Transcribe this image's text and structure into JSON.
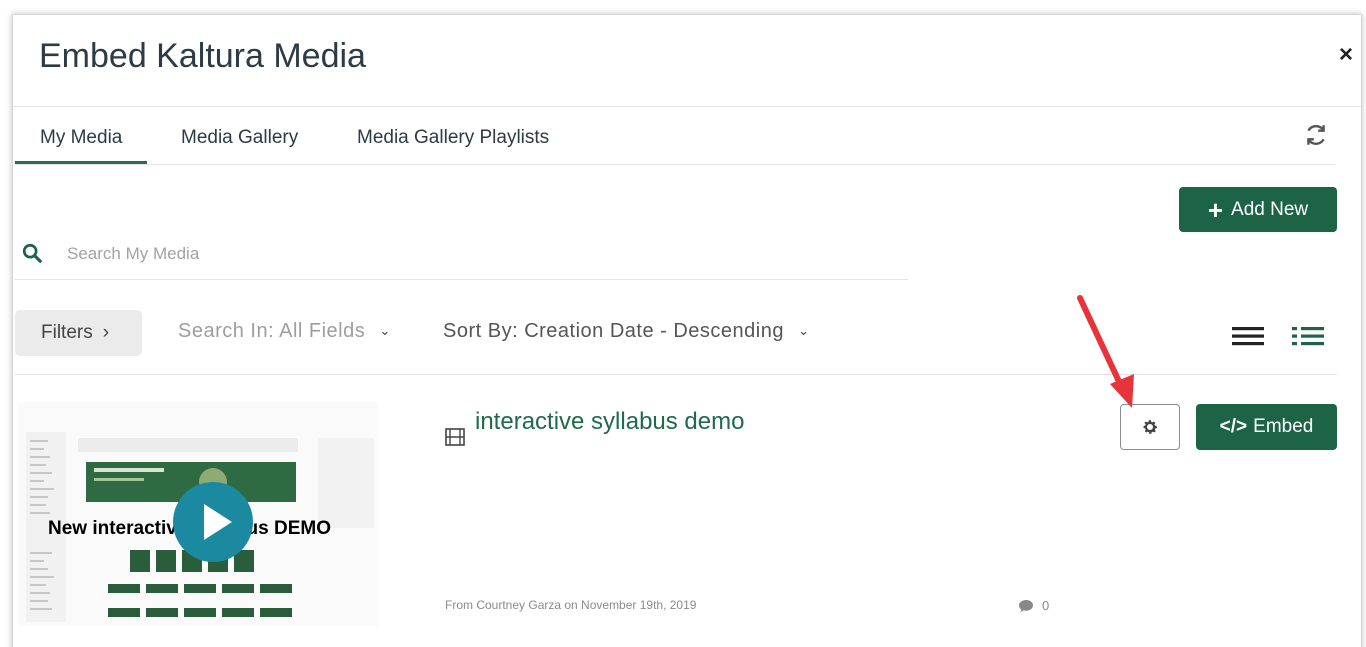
{
  "modal": {
    "title": "Embed Kaltura Media",
    "close_label": "×"
  },
  "tabs": [
    {
      "label": "My Media",
      "active": true
    },
    {
      "label": "Media Gallery",
      "active": false
    },
    {
      "label": "Media Gallery Playlists",
      "active": false
    }
  ],
  "toolbar": {
    "add_new_label": "Add New",
    "search_placeholder": "Search My Media",
    "filters_label": "Filters",
    "filters_chevron": "›",
    "search_in_label": "Search In: All Fields",
    "sort_by_label": "Sort By: Creation Date - Descending",
    "caret": "⌄"
  },
  "media_item": {
    "thumbnail_text": "New interactive syllabus DEMO",
    "title": "interactive syllabus demo",
    "embed_label": "Embed",
    "embed_code_icon": "</>",
    "meta": "From Courtney Garza on November 19th, 2019",
    "comment_count": "0"
  },
  "colors": {
    "accent": "#1d6447",
    "title_text": "#2d3b45",
    "link": "#1f6a4a",
    "annotation_arrow": "#e8333a"
  }
}
